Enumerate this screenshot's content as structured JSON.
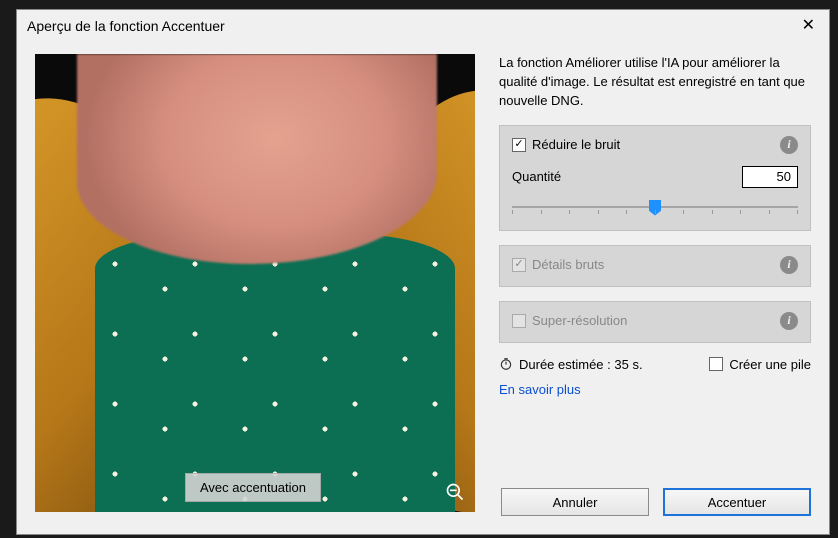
{
  "dialog": {
    "title": "Aperçu de la fonction Accentuer"
  },
  "preview": {
    "badge": "Avec accentuation"
  },
  "description": "La fonction Améliorer utilise l'IA pour améliorer la qualité d'image. Le résultat est enregistré en tant que nouvelle DNG.",
  "options": {
    "denoise": {
      "label": "Réduire le bruit",
      "amount_label": "Quantité",
      "amount_value": "50"
    },
    "raw_details": {
      "label": "Détails bruts"
    },
    "super_res": {
      "label": "Super-résolution"
    }
  },
  "meta": {
    "duration_label": "Durée estimée : 35 s.",
    "stack_label": "Créer une pile",
    "learn_more": "En savoir plus"
  },
  "buttons": {
    "cancel": "Annuler",
    "confirm": "Accentuer"
  }
}
